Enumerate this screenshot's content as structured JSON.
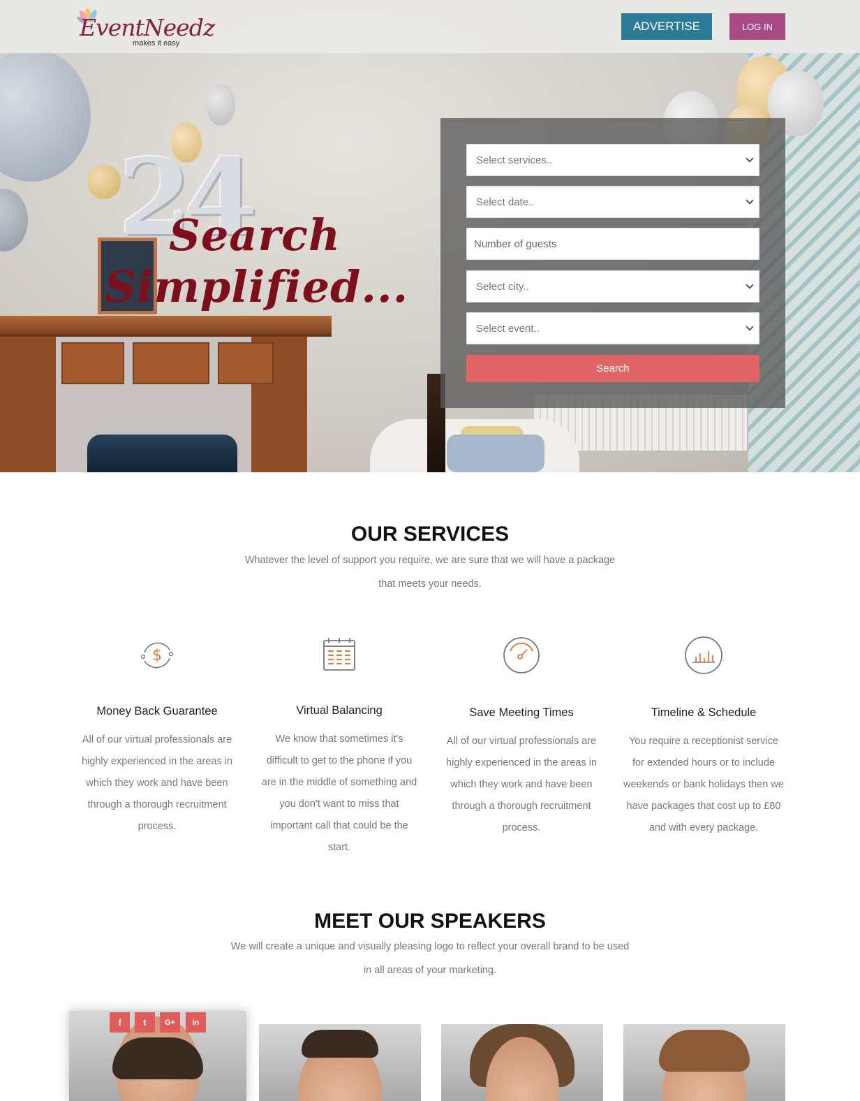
{
  "header": {
    "logo_word": "EventNeedz",
    "logo_tagline": "makes it easy",
    "advertise_label": "ADVERTISE",
    "login_label": "LOG IN"
  },
  "hero": {
    "title_line1": "Search",
    "title_line2": "Simplified...",
    "form": {
      "services_placeholder": "Select services..",
      "date_placeholder": "Select date..",
      "guests_placeholder": "Number of guests",
      "city_placeholder": "Select city..",
      "event_placeholder": "Select event..",
      "search_label": "Search"
    }
  },
  "services": {
    "title": "OUR SERVICES",
    "subtitle_line1": "Whatever the level of support you require, we are sure that we will have a package",
    "subtitle_line2": "that meets your needs.",
    "items": [
      {
        "icon": "money-back-icon",
        "title": "Money Back Guarantee",
        "lines": [
          "All of our virtual professionals are",
          "highly experienced in the areas in",
          "which they work and have been",
          "through a thorough recruitment",
          "process."
        ]
      },
      {
        "icon": "calendar-icon",
        "title": "Virtual Balancing",
        "lines": [
          "We know that sometimes it's",
          "difficult to get to the phone if you",
          "are in the middle of something and",
          "you don't want to miss that",
          "important call that could be the",
          "start."
        ]
      },
      {
        "icon": "speedometer-icon",
        "title": "Save Meeting Times",
        "lines": [
          "All of our virtual professionals are",
          "highly experienced in the areas in",
          "which they work and have been",
          "through a thorough recruitment",
          "process."
        ]
      },
      {
        "icon": "bar-chart-icon",
        "title": "Timeline & Schedule",
        "lines": [
          "You require a receptionist service",
          "for extended hours or to include",
          "weekends or bank holidays then we",
          "have packages that cost up to £80",
          "and with every package."
        ]
      }
    ]
  },
  "speakers": {
    "title": "MEET OUR SPEAKERS",
    "subtitle_line1": "We will create a unique and visually pleasing logo to reflect your overall brand to be used",
    "subtitle_line2": "in all areas of your marketing.",
    "social": [
      "f",
      "t",
      "G+",
      "in"
    ]
  },
  "colors": {
    "advertise": "#2c7b96",
    "login": "#a84a84",
    "search_button": "#e06566",
    "accent_orange": "#e07a3a",
    "social": "#e05c5c"
  }
}
